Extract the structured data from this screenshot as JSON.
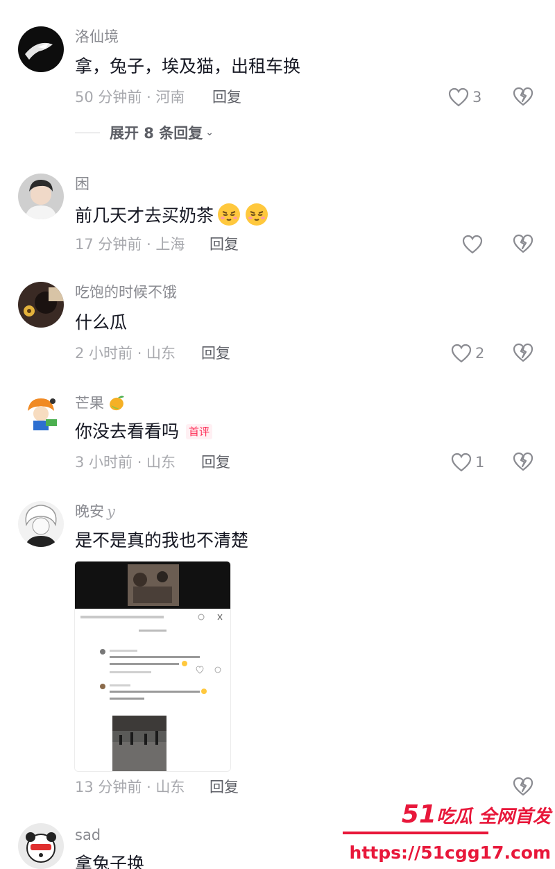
{
  "colors": {
    "text": "#161823",
    "secondary": "#8a8b91",
    "meta": "#a7a8ad",
    "accent": "#fe2c55",
    "watermark": "#e8173a"
  },
  "comments": [
    {
      "username": "洛仙境",
      "text": "拿，兔子，埃及猫，出租车换",
      "time_location": "50 分钟前 · 河南",
      "reply": "回复",
      "likes": "3",
      "expand": "展开 8 条回复"
    },
    {
      "username": "困",
      "text": "前几天才去买奶茶",
      "time_location": "17 分钟前 · 上海",
      "reply": "回复",
      "likes": "",
      "emoji": "pouting-face"
    },
    {
      "username": "吃饱的时候不饿",
      "text": "什么瓜",
      "time_location": "2 小时前 · 山东",
      "reply": "回复",
      "likes": "2"
    },
    {
      "username": "芒果",
      "username_icon": "mango-icon",
      "text": "你没去看看吗",
      "badge": "首评",
      "time_location": "3 小时前 · 山东",
      "reply": "回复",
      "likes": "1"
    },
    {
      "username": "晚安",
      "username_flair": "y",
      "text": "是不是真的我也不清楚",
      "time_location": "13 分钟前 · 山东",
      "reply": "回复",
      "has_image": true
    },
    {
      "username": "sad",
      "text": "拿兔子换"
    }
  ],
  "watermark": {
    "number": "51",
    "slogan": "吃瓜 全网首发",
    "url": "https://51cgg17.com"
  }
}
